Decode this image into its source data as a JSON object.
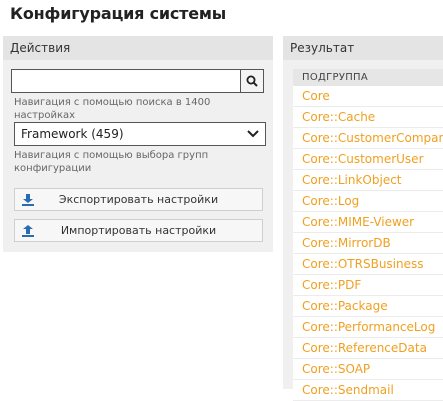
{
  "page": {
    "title": "Конфигурация системы"
  },
  "actions": {
    "header": "Действия",
    "search": {
      "value": "",
      "placeholder": ""
    },
    "search_hint": "Навигация с помощью поиска в 1400 настройках",
    "group_select": {
      "selected": "Framework (459)"
    },
    "group_hint": "Навигация с помощью выбора групп конфигурации",
    "export_label": "Экспортировать настройки",
    "import_label": "Импортировать настройки"
  },
  "results": {
    "header": "Результат",
    "column_header": "ПОДГРУППА",
    "rows": [
      "Core",
      "Core::Cache",
      "Core::CustomerCompany",
      "Core::CustomerUser",
      "Core::LinkObject",
      "Core::Log",
      "Core::MIME-Viewer",
      "Core::MirrorDB",
      "Core::OTRSBusiness",
      "Core::PDF",
      "Core::Package",
      "Core::PerformanceLog",
      "Core::ReferenceData",
      "Core::SOAP",
      "Core::Sendmail"
    ]
  },
  "icons": {
    "search": "search-icon",
    "dropdown": "chevron-down-icon",
    "export": "download-icon",
    "import": "upload-icon"
  },
  "colors": {
    "link": "#f0a020",
    "panel": "#f0f0f0",
    "icon_blue": "#2a6cb0"
  }
}
